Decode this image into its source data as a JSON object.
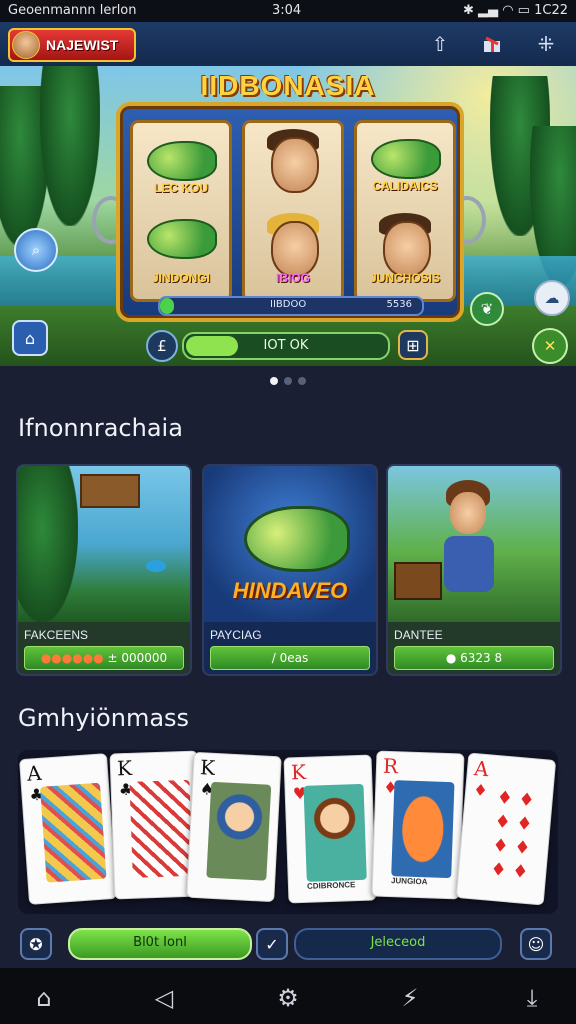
{
  "status_bar": {
    "left_text": "Geoenmannn lerlon",
    "center_text": "3:04",
    "right_text": "1C22"
  },
  "header": {
    "brand_label": "NAJEWIST",
    "icons": [
      "up-arrow-icon",
      "gift-box-icon",
      "grid-menu-icon"
    ]
  },
  "banner": {
    "title": "IIDBONASIA",
    "reels": [
      {
        "top_label": "LEC KOU",
        "bottom_label": "JINDONGI"
      },
      {
        "top_label": "",
        "bottom_label": "IBIOG"
      },
      {
        "top_label": "CALIDAICS",
        "bottom_label": "JUNCHOSIS"
      }
    ],
    "machine_bar_left": "IIBDOO",
    "machine_bar_right": "5536",
    "spin_label": "IOT OK",
    "pager": {
      "count": 3,
      "active": 0
    }
  },
  "section1": {
    "title": "Ifnonnrachaia",
    "games": [
      {
        "name": "FAKCEENS",
        "pill_label": "± 000000",
        "pill_rating": 5
      },
      {
        "name": "PAYCIAG",
        "pill_label": "/ 0eas",
        "logo": "HINDAVEO"
      },
      {
        "name": "DANTEE",
        "pill_label": "● 6323 8"
      }
    ]
  },
  "section2": {
    "title": "Gmhyiönmass",
    "cards": [
      {
        "rank": "A",
        "suit": "♣",
        "color": "black"
      },
      {
        "rank": "K",
        "suit": "♣",
        "color": "black"
      },
      {
        "rank": "K",
        "suit": "♠",
        "color": "black"
      },
      {
        "rank": "K",
        "suit": "♥",
        "color": "red",
        "caption": "CDIBRONCE"
      },
      {
        "rank": "R",
        "suit": "♦",
        "color": "red",
        "caption": "JUNGIOA"
      },
      {
        "rank": "A",
        "suit": "♦",
        "color": "red"
      }
    ],
    "bottom_left_label": "Bl0t Ionl",
    "bottom_right_label": "Jeleceod"
  },
  "colors": {
    "accent_green": "#5fc23b",
    "header_blue": "#1e3a66",
    "gold": "#ffd23f",
    "bg": "#1b1f33"
  },
  "nav": {
    "icons": [
      "home-icon",
      "back-icon",
      "settings-icon",
      "lightning-icon",
      "download-icon"
    ]
  }
}
